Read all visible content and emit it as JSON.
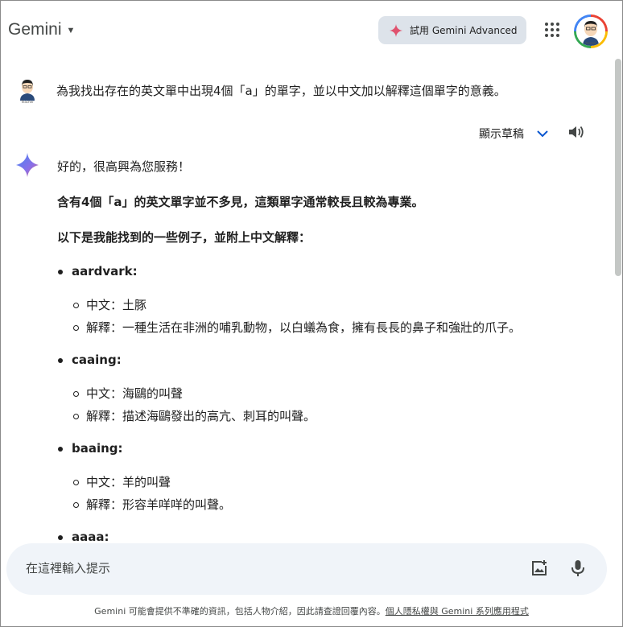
{
  "header": {
    "brand": "Gemini",
    "advanced_button": "試用 Gemini Advanced",
    "avatar_caption": "Teacher"
  },
  "prompt": {
    "text": "為我找出存在的英文單中出現4個「a」的單字，並以中文加以解釋這個單字的意義。",
    "avatar_caption": "Teacher"
  },
  "toolbar": {
    "drafts_label": "顯示草稿"
  },
  "response": {
    "greeting": "好的，很高興為您服務！",
    "intro": "含有4個「a」的英文單字並不多見，這類單字通常較長且較為專業。",
    "lead": "以下是我能找到的一些例子，並附上中文解釋：",
    "words": [
      {
        "word": "aardvark:",
        "chinese": "中文：土豚",
        "explanation": "解釋：一種生活在非洲的哺乳動物，以白蟻為食，擁有長長的鼻子和強壯的爪子。"
      },
      {
        "word": "caaing:",
        "chinese": "中文：海鷗的叫聲",
        "explanation": "解釋：描述海鷗發出的高亢、刺耳的叫聲。"
      },
      {
        "word": "baaing:",
        "chinese": "中文：羊的叫聲",
        "explanation": "解釋：形容羊咩咩的叫聲。"
      },
      {
        "word": "aaaa:"
      }
    ]
  },
  "input": {
    "placeholder": "在這裡輸入提示"
  },
  "footer": {
    "disclaimer": "Gemini 可能會提供不準確的資訊，包括人物介紹，因此請查證回覆內容。",
    "link": "個人隱私權與 Gemini 系列應用程式"
  },
  "colors": {
    "accent_blue": "#4285f4",
    "pill_bg": "#dde3ea",
    "input_bg": "#f0f4f9"
  },
  "icons": [
    "caret-down-icon",
    "sparkle-icon",
    "apps-grid-icon",
    "chevron-down-icon",
    "speaker-icon",
    "gemini-sparkle-icon",
    "add-image-icon",
    "microphone-icon"
  ]
}
